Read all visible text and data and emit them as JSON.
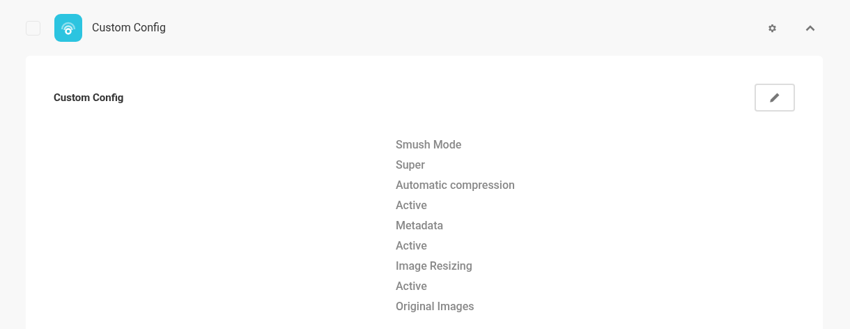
{
  "header": {
    "checked": false,
    "title": "Custom Config"
  },
  "card": {
    "title": "Custom Config",
    "settings": [
      {
        "label": "Smush Mode",
        "value": "Super"
      },
      {
        "label": "Automatic compression",
        "value": "Active"
      },
      {
        "label": "Metadata",
        "value": "Active"
      },
      {
        "label": "Image Resizing",
        "value": "Active"
      },
      {
        "label": "Original Images"
      }
    ]
  }
}
